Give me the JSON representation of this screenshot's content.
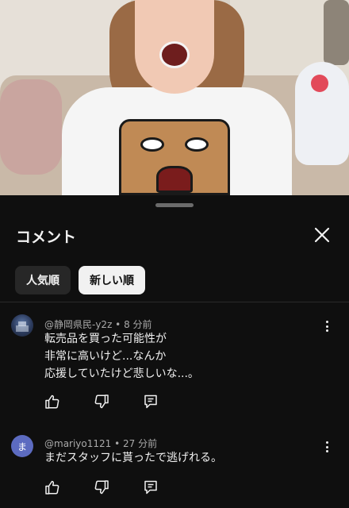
{
  "sheet": {
    "title": "コメント",
    "close_icon": "close-icon",
    "sort_chips": [
      {
        "label": "人気順",
        "selected": false
      },
      {
        "label": "新しい順",
        "selected": true
      }
    ]
  },
  "comments": [
    {
      "author": "@静岡県民-y2z",
      "time": "8 分前",
      "meta": "@静岡県民-y2z • 8 分前",
      "text": "転売品を買った可能性が\n非常に高いけど...なんか\n応援していたけど悲しいな...。",
      "avatar_type": "image"
    },
    {
      "author": "@mariyo1121",
      "time": "27 分前",
      "meta": "@mariyo1121 • 27 分前",
      "text": "まだスタッフに貰ったで逃げれる。",
      "avatar_letter": "ま",
      "avatar_type": "letter"
    }
  ],
  "icons": {
    "like": "thumbs-up-icon",
    "dislike": "thumbs-down-icon",
    "reply": "reply-icon",
    "more": "more-vertical-icon"
  },
  "colors": {
    "background": "#0f0f0f",
    "chip_active_bg": "#f1f1f1",
    "chip_inactive_bg": "#272727",
    "meta_text": "#aaaaaa",
    "avatar_letter_bg": "#5c6bc0"
  }
}
